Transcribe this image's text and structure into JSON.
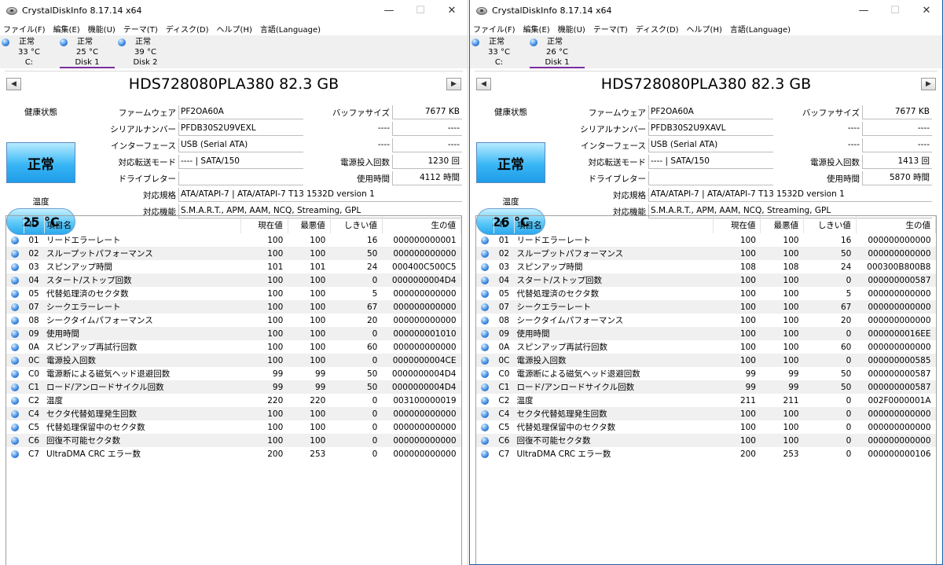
{
  "colors": {
    "accent": "#1a5fa8",
    "health_blue": "#39b6f5",
    "selected_tab_underline": "#7a2e9e"
  },
  "column_headers": {
    "id": "ID",
    "name": "項目名",
    "current": "現在値",
    "worst": "最悪値",
    "threshold": "しきい値",
    "raw": "生の値"
  },
  "info_labels": {
    "health": "健康状態",
    "temperature": "温度",
    "firmware": "ファームウェア",
    "serial": "シリアルナンバー",
    "interface": "インターフェース",
    "transfer": "対応転送モード",
    "drive_letter": "ドライブレター",
    "standard": "対応規格",
    "features": "対応機能",
    "buffer": "バッファサイズ",
    "power_on_count": "電源投入回数",
    "power_on_hours": "使用時間"
  },
  "windows": [
    {
      "title": "CrystalDiskInfo 8.17.14 x64",
      "window_controls": {
        "minimize": "—",
        "maximize": "☐",
        "close": "✕"
      },
      "menu": [
        "ファイル(F)",
        "編集(E)",
        "機能(U)",
        "テーマ(T)",
        "ディスク(D)",
        "ヘルプ(H)",
        "言語(Language)"
      ],
      "disk_tabs": [
        {
          "status": "正常",
          "temp": "33 °C",
          "name": "C:"
        },
        {
          "status": "正常",
          "temp": "25 °C",
          "name": "Disk 1"
        },
        {
          "status": "正常",
          "temp": "39 °C",
          "name": "Disk 2"
        }
      ],
      "model": "HDS728080PLA380 82.3 GB",
      "arrow_left": "◀",
      "arrow_right": "▶",
      "health_status": "正常",
      "temperature": "25 °C",
      "firmware": "PF2OA60A",
      "serial": "PFDB30S2U9VEXL",
      "interface": "USB (Serial ATA)",
      "transfer": "---- | SATA/150",
      "drive_letter": "",
      "standard": "ATA/ATAPI-7 | ATA/ATAPI-7 T13 1532D version 1",
      "features": "S.M.A.R.T., APM, AAM, NCQ, Streaming, GPL",
      "buffer_size": "7677 KB",
      "blank_label_1": "----",
      "blank_val_1": "----",
      "blank_label_2": "----",
      "blank_val_2": "----",
      "power_on_count": "1230 回",
      "power_on_hours": "4112 時間",
      "attributes": [
        {
          "id": "01",
          "name": "リードエラーレート",
          "current": "100",
          "worst": "100",
          "threshold": "16",
          "raw": "000000000001"
        },
        {
          "id": "02",
          "name": "スループットパフォーマンス",
          "current": "100",
          "worst": "100",
          "threshold": "50",
          "raw": "000000000000"
        },
        {
          "id": "03",
          "name": "スピンアップ時間",
          "current": "101",
          "worst": "101",
          "threshold": "24",
          "raw": "000400C500C5"
        },
        {
          "id": "04",
          "name": "スタート/ストップ回数",
          "current": "100",
          "worst": "100",
          "threshold": "0",
          "raw": "0000000004D4"
        },
        {
          "id": "05",
          "name": "代替処理済のセクタ数",
          "current": "100",
          "worst": "100",
          "threshold": "5",
          "raw": "000000000000"
        },
        {
          "id": "07",
          "name": "シークエラーレート",
          "current": "100",
          "worst": "100",
          "threshold": "67",
          "raw": "000000000000"
        },
        {
          "id": "08",
          "name": "シークタイムパフォーマンス",
          "current": "100",
          "worst": "100",
          "threshold": "20",
          "raw": "000000000000"
        },
        {
          "id": "09",
          "name": "使用時間",
          "current": "100",
          "worst": "100",
          "threshold": "0",
          "raw": "000000001010"
        },
        {
          "id": "0A",
          "name": "スピンアップ再試行回数",
          "current": "100",
          "worst": "100",
          "threshold": "60",
          "raw": "000000000000"
        },
        {
          "id": "0C",
          "name": "電源投入回数",
          "current": "100",
          "worst": "100",
          "threshold": "0",
          "raw": "0000000004CE"
        },
        {
          "id": "C0",
          "name": "電源断による磁気ヘッド退避回数",
          "current": "99",
          "worst": "99",
          "threshold": "50",
          "raw": "0000000004D4"
        },
        {
          "id": "C1",
          "name": "ロード/アンロードサイクル回数",
          "current": "99",
          "worst": "99",
          "threshold": "50",
          "raw": "0000000004D4"
        },
        {
          "id": "C2",
          "name": "温度",
          "current": "220",
          "worst": "220",
          "threshold": "0",
          "raw": "003100000019"
        },
        {
          "id": "C4",
          "name": "セクタ代替処理発生回数",
          "current": "100",
          "worst": "100",
          "threshold": "0",
          "raw": "000000000000"
        },
        {
          "id": "C5",
          "name": "代替処理保留中のセクタ数",
          "current": "100",
          "worst": "100",
          "threshold": "0",
          "raw": "000000000000"
        },
        {
          "id": "C6",
          "name": "回復不可能セクタ数",
          "current": "100",
          "worst": "100",
          "threshold": "0",
          "raw": "000000000000"
        },
        {
          "id": "C7",
          "name": "UltraDMA CRC エラー数",
          "current": "200",
          "worst": "253",
          "threshold": "0",
          "raw": "000000000000"
        }
      ]
    },
    {
      "title": "CrystalDiskInfo 8.17.14 x64",
      "window_controls": {
        "minimize": "—",
        "maximize": "☐",
        "close": "✕"
      },
      "menu": [
        "ファイル(F)",
        "編集(E)",
        "機能(U)",
        "テーマ(T)",
        "ディスク(D)",
        "ヘルプ(H)",
        "言語(Language)"
      ],
      "disk_tabs": [
        {
          "status": "正常",
          "temp": "33 °C",
          "name": "C:"
        },
        {
          "status": "正常",
          "temp": "26 °C",
          "name": "Disk 1"
        }
      ],
      "model": "HDS728080PLA380 82.3 GB",
      "arrow_left": "◀",
      "arrow_right": "▶",
      "health_status": "正常",
      "temperature": "26 °C",
      "firmware": "PF2OA60A",
      "serial": "PFDB30S2U9XAVL",
      "interface": "USB (Serial ATA)",
      "transfer": "---- | SATA/150",
      "drive_letter": "",
      "standard": "ATA/ATAPI-7 | ATA/ATAPI-7 T13 1532D version 1",
      "features": "S.M.A.R.T., APM, AAM, NCQ, Streaming, GPL",
      "buffer_size": "7677 KB",
      "blank_label_1": "----",
      "blank_val_1": "----",
      "blank_label_2": "----",
      "blank_val_2": "----",
      "power_on_count": "1413 回",
      "power_on_hours": "5870 時間",
      "attributes": [
        {
          "id": "01",
          "name": "リードエラーレート",
          "current": "100",
          "worst": "100",
          "threshold": "16",
          "raw": "000000000000"
        },
        {
          "id": "02",
          "name": "スループットパフォーマンス",
          "current": "100",
          "worst": "100",
          "threshold": "50",
          "raw": "000000000000"
        },
        {
          "id": "03",
          "name": "スピンアップ時間",
          "current": "108",
          "worst": "108",
          "threshold": "24",
          "raw": "000300B800B8"
        },
        {
          "id": "04",
          "name": "スタート/ストップ回数",
          "current": "100",
          "worst": "100",
          "threshold": "0",
          "raw": "000000000587"
        },
        {
          "id": "05",
          "name": "代替処理済のセクタ数",
          "current": "100",
          "worst": "100",
          "threshold": "5",
          "raw": "000000000000"
        },
        {
          "id": "07",
          "name": "シークエラーレート",
          "current": "100",
          "worst": "100",
          "threshold": "67",
          "raw": "000000000000"
        },
        {
          "id": "08",
          "name": "シークタイムパフォーマンス",
          "current": "100",
          "worst": "100",
          "threshold": "20",
          "raw": "000000000000"
        },
        {
          "id": "09",
          "name": "使用時間",
          "current": "100",
          "worst": "100",
          "threshold": "0",
          "raw": "0000000016EE"
        },
        {
          "id": "0A",
          "name": "スピンアップ再試行回数",
          "current": "100",
          "worst": "100",
          "threshold": "60",
          "raw": "000000000000"
        },
        {
          "id": "0C",
          "name": "電源投入回数",
          "current": "100",
          "worst": "100",
          "threshold": "0",
          "raw": "000000000585"
        },
        {
          "id": "C0",
          "name": "電源断による磁気ヘッド退避回数",
          "current": "99",
          "worst": "99",
          "threshold": "50",
          "raw": "000000000587"
        },
        {
          "id": "C1",
          "name": "ロード/アンロードサイクル回数",
          "current": "99",
          "worst": "99",
          "threshold": "50",
          "raw": "000000000587"
        },
        {
          "id": "C2",
          "name": "温度",
          "current": "211",
          "worst": "211",
          "threshold": "0",
          "raw": "002F0000001A"
        },
        {
          "id": "C4",
          "name": "セクタ代替処理発生回数",
          "current": "100",
          "worst": "100",
          "threshold": "0",
          "raw": "000000000000"
        },
        {
          "id": "C5",
          "name": "代替処理保留中のセクタ数",
          "current": "100",
          "worst": "100",
          "threshold": "0",
          "raw": "000000000000"
        },
        {
          "id": "C6",
          "name": "回復不可能セクタ数",
          "current": "100",
          "worst": "100",
          "threshold": "0",
          "raw": "000000000000"
        },
        {
          "id": "C7",
          "name": "UltraDMA CRC エラー数",
          "current": "200",
          "worst": "253",
          "threshold": "0",
          "raw": "000000000106"
        }
      ]
    }
  ]
}
